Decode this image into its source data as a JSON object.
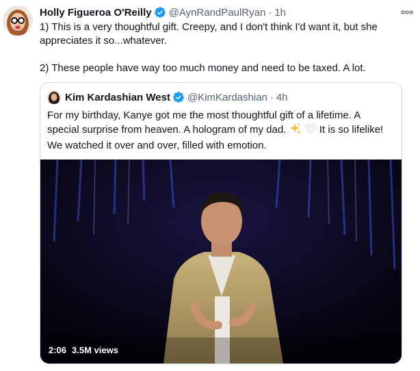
{
  "tweet": {
    "author_name": "Holly Figueroa O'Reilly",
    "author_handle": "@AynRandPaulRyan",
    "separator": "·",
    "time": "1h",
    "paragraph_1": "1) This is a very thoughtful gift. Creepy, and I don't think I'd want it, but she appreciates it so...whatever.",
    "paragraph_2": "2) These people have way too much money and need to be taxed. A lot.",
    "more_icon": "more-horizontal-icon"
  },
  "quoted_tweet": {
    "author_name": "Kim Kardashian West",
    "author_handle": "@KimKardashian",
    "separator": "·",
    "time": "4h",
    "text_main": "For my birthday, Kanye got me the most thoughtful gift of a lifetime. A special surprise from heaven. A hologram of my dad.",
    "text_tail": "It is so lifelike! We watched it over and over, filled with emotion.",
    "emojis": [
      "sparkles",
      "white-heart"
    ]
  },
  "video": {
    "duration": "2:06",
    "views": "3.5M views"
  },
  "colors": {
    "verified": "#1d9bf0",
    "text": "#0f1419",
    "secondary": "#536471",
    "border": "#cfd9de"
  }
}
